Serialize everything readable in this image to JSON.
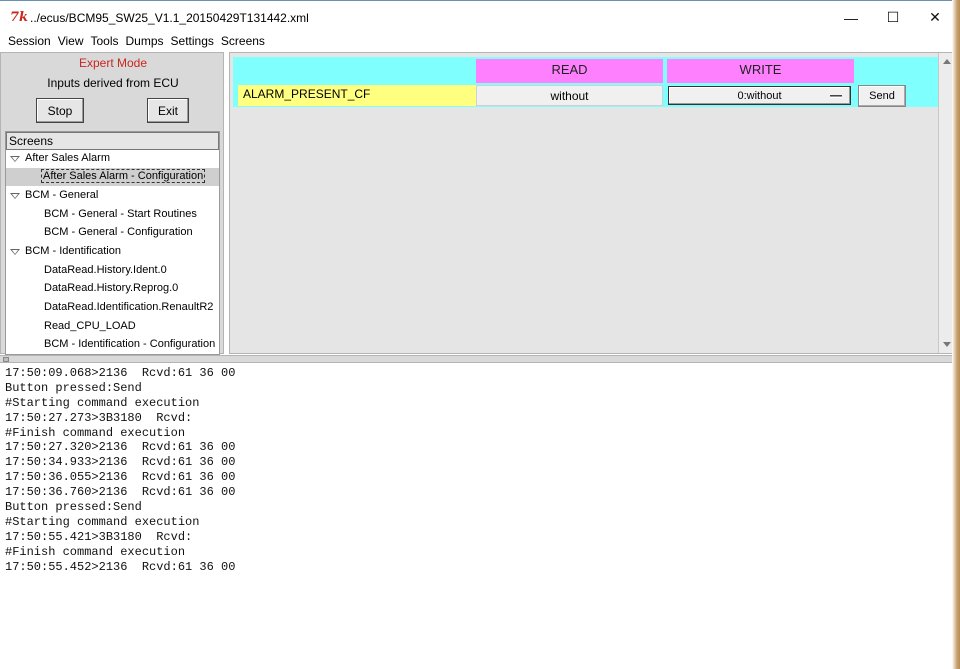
{
  "window": {
    "icon_text": "7k",
    "title": "../ecus/BCM95_SW25_V1.1_20150429T131442.xml",
    "minimize_glyph": "—",
    "maximize_glyph": "☐",
    "close_glyph": "✕"
  },
  "menu": [
    "Session",
    "View",
    "Tools",
    "Dumps",
    "Settings",
    "Screens"
  ],
  "left_panel": {
    "mode": "Expert Mode",
    "info": "Inputs derived from ECU",
    "stop_label": "Stop",
    "exit_label": "Exit",
    "tree_header": "Screens",
    "tree": [
      {
        "label": "After Sales Alarm",
        "type": "group"
      },
      {
        "label": "After Sales Alarm - Configuration",
        "type": "child",
        "selected": true
      },
      {
        "label": "BCM - General",
        "type": "group"
      },
      {
        "label": "BCM - General - Start Routines",
        "type": "child"
      },
      {
        "label": "BCM - General - Configuration",
        "type": "child"
      },
      {
        "label": "BCM - Identification",
        "type": "group"
      },
      {
        "label": "DataRead.History.Ident.0",
        "type": "child"
      },
      {
        "label": "DataRead.History.Reprog.0",
        "type": "child"
      },
      {
        "label": "DataRead.Identification.RenaultR2",
        "type": "child"
      },
      {
        "label": "Read_CPU_LOAD",
        "type": "child"
      },
      {
        "label": "BCM - Identification - Configuration",
        "type": "child"
      }
    ]
  },
  "screen": {
    "read_header": "READ",
    "write_header": "WRITE",
    "param_name": "ALARM_PRESENT_CF",
    "read_value": "without",
    "write_value": "0:without",
    "send_label": "Send",
    "colors": {
      "band": "#80ffff",
      "header": "#ff80ff",
      "param": "#ffff80"
    }
  },
  "log": [
    "17:50:09.068>2136  Rcvd:61 36 00",
    "Button pressed:Send",
    "#Starting command execution",
    "17:50:27.273>3B3180  Rcvd:",
    "#Finish command execution",
    "17:50:27.320>2136  Rcvd:61 36 00",
    "17:50:34.933>2136  Rcvd:61 36 00",
    "17:50:36.055>2136  Rcvd:61 36 00",
    "17:50:36.760>2136  Rcvd:61 36 00",
    "Button pressed:Send",
    "#Starting command execution",
    "17:50:55.421>3B3180  Rcvd:",
    "#Finish command execution",
    "17:50:55.452>2136  Rcvd:61 36 00"
  ]
}
